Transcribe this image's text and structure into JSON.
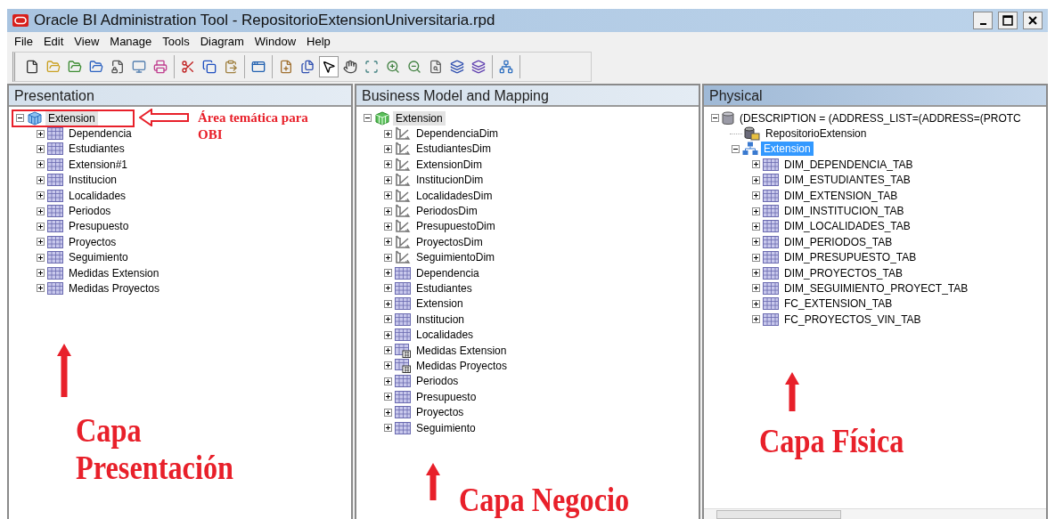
{
  "window": {
    "title": "Oracle BI Administration Tool - RepositorioExtensionUniversitaria.rpd"
  },
  "menu": [
    "File",
    "Edit",
    "View",
    "Manage",
    "Tools",
    "Diagram",
    "Window",
    "Help"
  ],
  "toolbar": [
    [
      {
        "pressed": false
      },
      {
        "pressed": false
      },
      {
        "pressed": false
      },
      {
        "pressed": false
      },
      {
        "pressed": false
      },
      {
        "pressed": false
      },
      {
        "pressed": false
      }
    ],
    [
      {
        "pressed": false
      },
      {
        "pressed": false
      },
      {
        "pressed": false
      }
    ],
    [
      {
        "pressed": false
      }
    ],
    [
      {
        "pressed": false
      },
      {
        "pressed": false
      },
      {
        "pressed": true
      },
      {
        "pressed": false
      },
      {
        "pressed": false
      },
      {
        "pressed": false
      },
      {
        "pressed": false
      },
      {
        "pressed": false
      },
      {
        "pressed": false
      },
      {
        "pressed": false
      }
    ],
    [
      {
        "pressed": false
      }
    ]
  ],
  "panes": [
    {
      "title": "Presentation",
      "active": false,
      "tree": [
        {
          "label": "Extension",
          "kind": "subject",
          "expanded": true,
          "selected": true,
          "children": [
            {
              "label": "Dependencia",
              "kind": "table",
              "expanded": false,
              "selected": false
            },
            {
              "label": "Estudiantes",
              "kind": "table",
              "expanded": false,
              "selected": false
            },
            {
              "label": "Extension#1",
              "kind": "table",
              "expanded": false,
              "selected": false
            },
            {
              "label": "Institucion",
              "kind": "table",
              "expanded": false,
              "selected": false
            },
            {
              "label": "Localidades",
              "kind": "table",
              "expanded": false,
              "selected": false
            },
            {
              "label": "Periodos",
              "kind": "table",
              "expanded": false,
              "selected": false
            },
            {
              "label": "Presupuesto",
              "kind": "table",
              "expanded": false,
              "selected": false
            },
            {
              "label": "Proyectos",
              "kind": "table",
              "expanded": false,
              "selected": false
            },
            {
              "label": "Seguimiento",
              "kind": "table",
              "expanded": false,
              "selected": false
            },
            {
              "label": "Medidas Extension",
              "kind": "table",
              "expanded": false,
              "selected": false
            },
            {
              "label": "Medidas Proyectos",
              "kind": "table",
              "expanded": false,
              "selected": false
            }
          ]
        }
      ],
      "annotations": [
        {
          "kind": "callout",
          "text": "Área temática para OBI"
        },
        {
          "kind": "layer",
          "text": "Capa Presentación"
        }
      ]
    },
    {
      "title": "Business Model and Mapping",
      "active": false,
      "tree": [
        {
          "label": "Extension",
          "kind": "model",
          "expanded": true,
          "selected": true,
          "children": [
            {
              "label": "DependenciaDim",
              "kind": "dimension",
              "expanded": false,
              "selected": false
            },
            {
              "label": "EstudiantesDim",
              "kind": "dimension",
              "expanded": false,
              "selected": false
            },
            {
              "label": "ExtensionDim",
              "kind": "dimension",
              "expanded": false,
              "selected": false
            },
            {
              "label": "InstitucionDim",
              "kind": "dimension",
              "expanded": false,
              "selected": false
            },
            {
              "label": "LocalidadesDim",
              "kind": "dimension",
              "expanded": false,
              "selected": false
            },
            {
              "label": "PeriodosDim",
              "kind": "dimension",
              "expanded": false,
              "selected": false
            },
            {
              "label": "PresupuestoDim",
              "kind": "dimension",
              "expanded": false,
              "selected": false
            },
            {
              "label": "ProyectosDim",
              "kind": "dimension",
              "expanded": false,
              "selected": false
            },
            {
              "label": "SeguimientoDim",
              "kind": "dimension",
              "expanded": false,
              "selected": false
            },
            {
              "label": "Dependencia",
              "kind": "table",
              "expanded": false,
              "selected": false
            },
            {
              "label": "Estudiantes",
              "kind": "table",
              "expanded": false,
              "selected": false
            },
            {
              "label": "Extension",
              "kind": "table",
              "expanded": false,
              "selected": false
            },
            {
              "label": "Institucion",
              "kind": "table",
              "expanded": false,
              "selected": false
            },
            {
              "label": "Localidades",
              "kind": "table",
              "expanded": false,
              "selected": false
            },
            {
              "label": "Medidas Extension",
              "kind": "fact",
              "expanded": false,
              "selected": false
            },
            {
              "label": "Medidas Proyectos",
              "kind": "fact",
              "expanded": false,
              "selected": false
            },
            {
              "label": "Periodos",
              "kind": "table",
              "expanded": false,
              "selected": false
            },
            {
              "label": "Presupuesto",
              "kind": "table",
              "expanded": false,
              "selected": false
            },
            {
              "label": "Proyectos",
              "kind": "table",
              "expanded": false,
              "selected": false
            },
            {
              "label": "Seguimiento",
              "kind": "table",
              "expanded": false,
              "selected": false
            }
          ]
        }
      ],
      "annotations": [
        {
          "kind": "layer",
          "text": "Capa Negocio"
        }
      ]
    },
    {
      "title": "Physical",
      "active": true,
      "tree": [
        {
          "label": "(DESCRIPTION = (ADDRESS_LIST=(ADDRESS=(PROTC",
          "kind": "database",
          "expanded": true,
          "selected": false,
          "children": [
            {
              "label": "RepositorioExtension",
              "kind": "connection",
              "selected": false
            },
            {
              "label": "Extension",
              "kind": "schema",
              "expanded": true,
              "selected": true,
              "children": [
                {
                  "label": "DIM_DEPENDENCIA_TAB",
                  "kind": "table",
                  "expanded": false,
                  "selected": false
                },
                {
                  "label": "DIM_ESTUDIANTES_TAB",
                  "kind": "table",
                  "expanded": false,
                  "selected": false
                },
                {
                  "label": "DIM_EXTENSION_TAB",
                  "kind": "table",
                  "expanded": false,
                  "selected": false
                },
                {
                  "label": "DIM_INSTITUCION_TAB",
                  "kind": "table",
                  "expanded": false,
                  "selected": false
                },
                {
                  "label": "DIM_LOCALIDADES_TAB",
                  "kind": "table",
                  "expanded": false,
                  "selected": false
                },
                {
                  "label": "DIM_PERIODOS_TAB",
                  "kind": "table",
                  "expanded": false,
                  "selected": false
                },
                {
                  "label": "DIM_PRESUPUESTO_TAB",
                  "kind": "table",
                  "expanded": false,
                  "selected": false
                },
                {
                  "label": "DIM_PROYECTOS_TAB",
                  "kind": "table",
                  "expanded": false,
                  "selected": false
                },
                {
                  "label": "DIM_SEGUIMIENTO_PROYECT_TAB",
                  "kind": "table",
                  "expanded": false,
                  "selected": false
                },
                {
                  "label": "FC_EXTENSION_TAB",
                  "kind": "table",
                  "expanded": false,
                  "selected": false
                },
                {
                  "label": "FC_PROYECTOS_VIN_TAB",
                  "kind": "table",
                  "expanded": false,
                  "selected": false
                }
              ]
            }
          ]
        }
      ],
      "annotations": [
        {
          "kind": "layer",
          "text": "Capa Física"
        }
      ]
    }
  ]
}
